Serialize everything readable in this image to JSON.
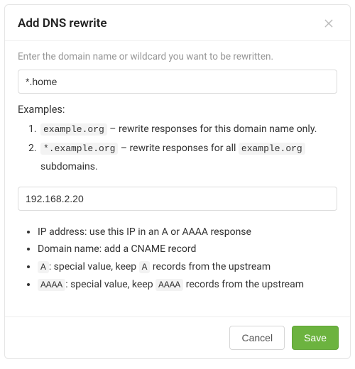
{
  "modal": {
    "title": "Add DNS rewrite",
    "hint": "Enter the domain name or wildcard you want to be rewritten.",
    "domain_input": {
      "value": "*.home"
    },
    "examples_label": "Examples:",
    "examples": [
      {
        "code": "example.org",
        "text_after": " – rewrite responses for this domain name only."
      },
      {
        "code": "*.example.org",
        "text_after": " – rewrite responses for all ",
        "code2": "example.org",
        "text_after2": " subdomains."
      }
    ],
    "answer_input": {
      "value": "192.168.2.20"
    },
    "notes": [
      {
        "text": "IP address: use this IP in an A or AAAA response"
      },
      {
        "text": "Domain name: add a CNAME record"
      },
      {
        "code": "A",
        "text_after": ": special value, keep ",
        "code2": "A",
        "text_after2": " records from the upstream"
      },
      {
        "code": "AAAA",
        "text_after": ": special value, keep ",
        "code2": "AAAA",
        "text_after2": " records from the upstream"
      }
    ],
    "footer": {
      "cancel": "Cancel",
      "save": "Save"
    }
  }
}
